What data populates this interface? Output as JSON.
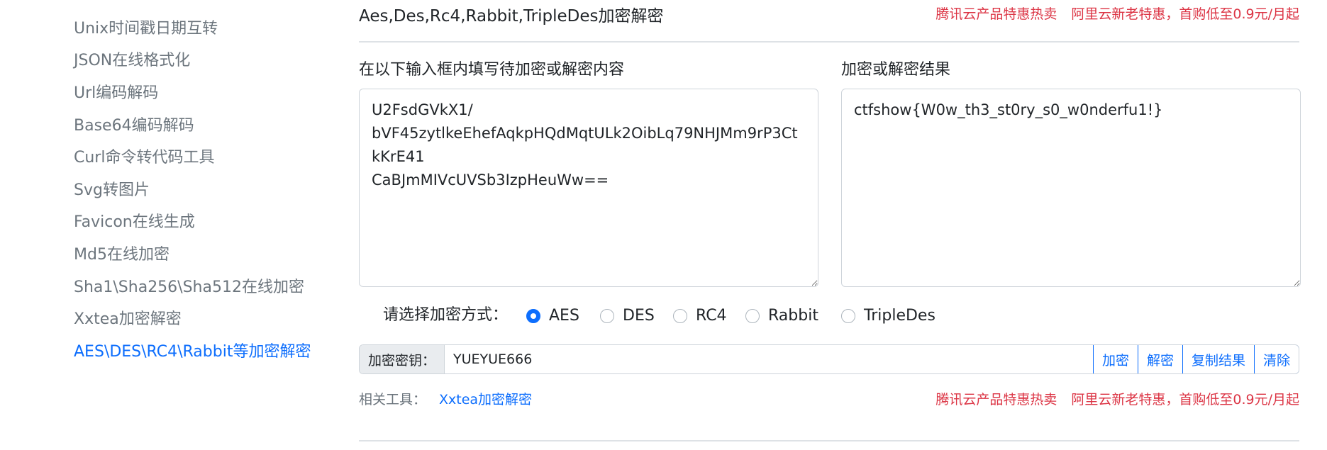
{
  "sidebar": {
    "items": [
      {
        "label": "Unix时间戳日期互转"
      },
      {
        "label": "JSON在线格式化"
      },
      {
        "label": "Url编码解码"
      },
      {
        "label": "Base64编码解码"
      },
      {
        "label": "Curl命令转代码工具"
      },
      {
        "label": "Svg转图片"
      },
      {
        "label": "Favicon在线生成"
      },
      {
        "label": "Md5在线加密"
      },
      {
        "label": "Sha1\\Sha256\\Sha512在线加密"
      },
      {
        "label": "Xxtea加密解密"
      },
      {
        "label": "AES\\DES\\RC4\\Rabbit等加密解密",
        "active": true
      }
    ]
  },
  "header": {
    "title": "Aes,Des,Rc4,Rabbit,TripleDes加密解密",
    "promo_1": "腾讯云产品特惠热卖",
    "promo_2": "阿里云新老特惠，首购低至0.9元/月起"
  },
  "input": {
    "label": "在以下输入框内填写待加密或解密内容",
    "value": "U2FsdGVkX1/\nbVF45zytlkeEhefAqkpHQdMqtULk2OibLq79NHJMm9rP3CtkKrE41\nCaBJmMIVcUVSb3IzpHeuWw=="
  },
  "output": {
    "label": "加密或解密结果",
    "value": "ctfshow{W0w_th3_st0ry_s0_w0nderfu1!}"
  },
  "method": {
    "label": "请选择加密方式：",
    "options": [
      {
        "label": "AES",
        "checked": true
      },
      {
        "label": "DES",
        "checked": false
      },
      {
        "label": "RC4",
        "checked": false
      },
      {
        "label": "Rabbit",
        "checked": false
      },
      {
        "label": "TripleDes",
        "checked": false
      }
    ]
  },
  "key": {
    "label": "加密密钥：",
    "value": "YUEYUE666"
  },
  "buttons": {
    "encrypt": "加密",
    "decrypt": "解密",
    "copy": "复制结果",
    "clear": "清除"
  },
  "related": {
    "label": "相关工具：",
    "link": "Xxtea加密解密"
  },
  "footer_promo": {
    "promo_1": "腾讯云产品特惠热卖",
    "promo_2": "阿里云新老特惠，首购低至0.9元/月起"
  },
  "colors": {
    "accent": "#0d6efd",
    "promo": "#dc3545",
    "muted": "#6c757d"
  }
}
